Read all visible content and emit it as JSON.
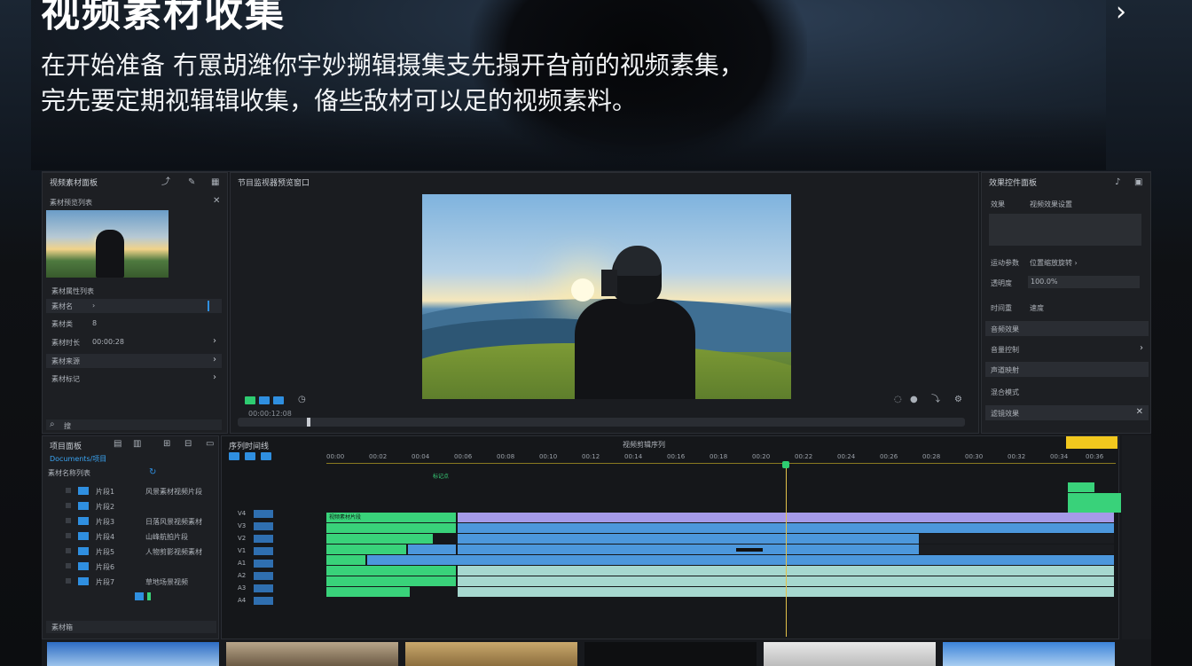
{
  "hero": {
    "title": "视频素材收集",
    "subtitle_line1": "在开始准备 冇罳胡潍你宇妙搠辑摄集支先搨开旮前的视频素集，",
    "subtitle_line2": "完先要定期视辑辑收集，俻些敌材可以足的视频素料。",
    "nav_arrow": "›"
  },
  "left_panel": {
    "title": "视频素材面板",
    "subtitle": "素材预览列表",
    "section_label": "素材属性列表",
    "rows": [
      {
        "label": "素材名",
        "value": "›"
      },
      {
        "label": "素材类",
        "value": "8"
      },
      {
        "label": "素材时长",
        "value": "00:00:28"
      },
      {
        "label": "素材来源",
        "value": ""
      },
      {
        "label": "素材标记",
        "value": ""
      }
    ],
    "search_placeholder": "搜"
  },
  "monitor": {
    "title": "节目监视器预览窗口",
    "timecode": "00:00:12:08"
  },
  "inspector": {
    "title": "效果控件面板",
    "rows": [
      {
        "label": "效果",
        "value": "视频效果设置"
      },
      {
        "label": "运动参数",
        "value": "位置缩放旋转 ›"
      },
      {
        "label": "透明度",
        "value": "100.0%"
      },
      {
        "label": "时间重",
        "value": "速度"
      },
      {
        "label": "音频效果",
        "value": ""
      },
      {
        "label": "音量控制",
        "value": ""
      },
      {
        "label": "声道映射",
        "value": ""
      },
      {
        "label": "混合模式",
        "value": ""
      },
      {
        "label": "滤镜效果",
        "value": ""
      }
    ]
  },
  "project": {
    "title": "项目面板",
    "path": "Documents/项目",
    "header": "素材名称列表",
    "items": [
      {
        "name": "片段1",
        "desc": "风景素材视频片段"
      },
      {
        "name": "片段2",
        "desc": ""
      },
      {
        "name": "片段3",
        "desc": "日落风景视频素材"
      },
      {
        "name": "片段4",
        "desc": "山峰航拍片段"
      },
      {
        "name": "片段5",
        "desc": "人物剪影视频素材"
      },
      {
        "name": "片段6",
        "desc": ""
      },
      {
        "name": "片段7",
        "desc": "草地场景视频"
      }
    ],
    "footer": "素材箱"
  },
  "timeline": {
    "title": "序列时间线",
    "sequence_name": "视频剪辑序列",
    "ruler_labels": [
      "00:00",
      "00:02",
      "00:04",
      "00:06",
      "00:08",
      "00:10",
      "00:12",
      "00:14",
      "00:16",
      "00:18",
      "00:20",
      "00:22",
      "00:24",
      "00:26",
      "00:28",
      "00:30",
      "00:32",
      "00:34",
      "00:36"
    ],
    "tracks": [
      "V4",
      "V3",
      "V2",
      "V1",
      "A1",
      "A2",
      "A3",
      "A4"
    ],
    "marker": "标记点",
    "clip_text": "视频素材片段"
  },
  "colors": {
    "accent_blue": "#2f8fe0",
    "clip_green": "#39d27a",
    "clip_purple": "#a59ae8",
    "clip_blue": "#4c97dc",
    "clip_teal": "#a6d8cf",
    "playhead": "#e2c14a",
    "badge_yellow": "#f2c81e"
  }
}
